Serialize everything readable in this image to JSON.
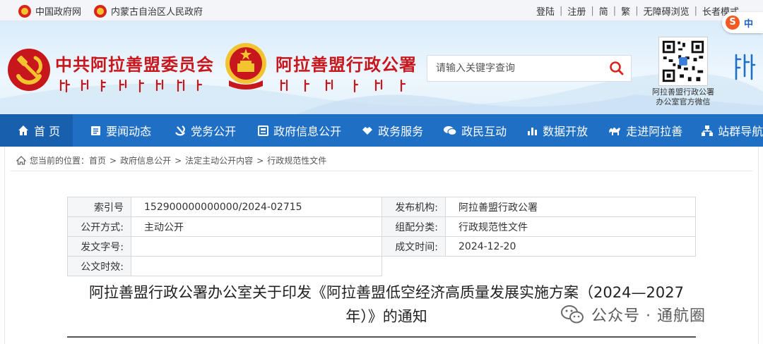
{
  "topbar": {
    "left_links": [
      {
        "label": "中国政府网"
      },
      {
        "label": "内蒙古自治区人民政府"
      }
    ],
    "right_links": [
      "登陆",
      "注册",
      "简",
      "繁",
      "无障碍浏览",
      "长者模式"
    ],
    "input_method": {
      "icon": "sogou-s-icon",
      "label": "中"
    }
  },
  "header": {
    "party_title": "中共阿拉善盟委员会",
    "gov_title": "阿拉善盟行政公署",
    "search": {
      "placeholder": "请输入关键字查询"
    },
    "qr_caption_line1": "阿拉善盟行政公署",
    "qr_caption_line2": "办公室官方微信"
  },
  "nav": {
    "items": [
      {
        "label": "首 页",
        "icon": "home-icon"
      },
      {
        "label": "要闻动态",
        "icon": "news-icon"
      },
      {
        "label": "党务公开",
        "icon": "party-icon"
      },
      {
        "label": "政府信息公开",
        "icon": "info-icon"
      },
      {
        "label": "政务服务",
        "icon": "service-icon"
      },
      {
        "label": "政民互动",
        "icon": "chat-icon"
      },
      {
        "label": "数据开放",
        "icon": "chart-icon"
      },
      {
        "label": "走进阿拉善",
        "icon": "camel-icon"
      },
      {
        "label": "站群导航",
        "icon": "sitemap-icon"
      }
    ]
  },
  "breadcrumb": {
    "prefix": "您当前的位置：",
    "items": [
      "首页",
      "政府信息公开",
      "法定主动公开内容",
      "行政规范性文件"
    ],
    "separator": ">"
  },
  "doc_info": {
    "index_label": "索引号",
    "index_value": "152900000000000/2024-02715",
    "publisher_label": "发布机构:",
    "publisher_value": "阿拉善盟行政公署",
    "method_label": "公开方式:",
    "method_value": "主动公开",
    "category_label": "组配分类:",
    "category_value": "行政规范性文件",
    "docno_label": "发文字号:",
    "docno_value": "",
    "date_label": "成文时间:",
    "date_value": "2024-12-20",
    "validity_label": "公文时效:",
    "validity_value": ""
  },
  "doc_title_line1": "阿拉善盟行政公署办公室关于印发《阿拉善盟低空经济高质量发展实施方案（2024—2027",
  "doc_title_line2": "年）》的通知",
  "watermark": {
    "text": "公众号 · 通航圈"
  },
  "colors": {
    "nav_bg": "#1f6fc5",
    "title_red": "#c8161d",
    "search_icon": "#d9261c"
  }
}
